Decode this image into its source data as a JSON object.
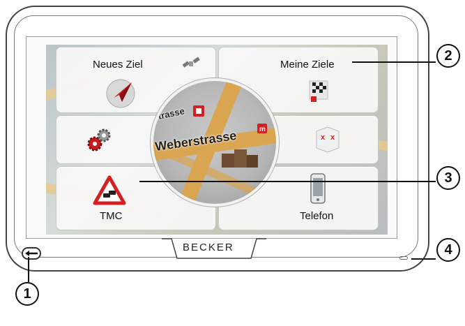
{
  "brand": {
    "logo_text": "BECKER"
  },
  "menu": {
    "new_destination_label": "Neues Ziel",
    "my_destinations_label": "Meine Ziele",
    "tmc_label": "TMC",
    "phone_label": "Telefon",
    "settings_label": "",
    "extras_label": ""
  },
  "map": {
    "street_main": "Weberstrasse",
    "street_secondary": "Strasse",
    "extras_icon_text": "x x"
  },
  "callouts": {
    "c1": "1",
    "c2": "2",
    "c3": "3",
    "c4": "4"
  },
  "colors": {
    "accent_red": "#d32020",
    "street_orange": "#e2a552"
  },
  "icons": [
    "compass-arrow-icon",
    "satellite-icon",
    "checkered-flag-icon",
    "gears-icon",
    "extras-icon",
    "traffic-warning-icon",
    "phone-icon",
    "back-arrow-icon"
  ]
}
